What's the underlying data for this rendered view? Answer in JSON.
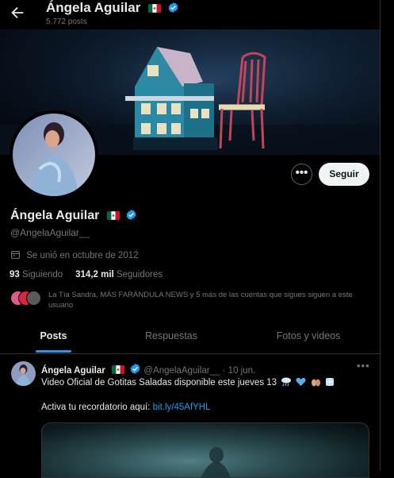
{
  "header": {
    "name": "Ángela Aguilar",
    "post_count": "5.772 posts"
  },
  "profile": {
    "name": "Ángela Aguilar",
    "handle": "@AngelaAguilar__",
    "joined": "Se unió en octubre de 2012",
    "following_count": "93",
    "following_label": "Siguiendo",
    "followers_count": "314,2 mil",
    "followers_label": "Seguidores",
    "followed_by_text": "La Tía Sandra, MÁS FARÁNDULA NEWS y 5 más de las cuentas que sigues siguen a este usuario",
    "more_button": "•••",
    "follow_button": "Seguir"
  },
  "tabs": [
    {
      "label": "Posts",
      "active": true
    },
    {
      "label": "Respuestas",
      "active": false
    },
    {
      "label": "Fotos y videos",
      "active": false
    }
  ],
  "tweet": {
    "name": "Ángela Aguilar",
    "handle": "@AngelaAguilar__",
    "separator": "·",
    "date": "10 jun.",
    "text_line1": "Video Oficial de Gotitas Saladas disponible este jueves 13",
    "emojis": [
      "cloud-rain",
      "blue-heart",
      "hands",
      "ice"
    ],
    "text_line2_prefix": "Activa tu recordatorio aquí: ",
    "link": "bit.ly/45AfYHL",
    "more": "•••"
  },
  "colors": {
    "background": "#000000",
    "accent": "#1d9bf0",
    "muted": "#71767b",
    "text": "#e7e9ea",
    "follow_bg": "#eff3f4"
  }
}
